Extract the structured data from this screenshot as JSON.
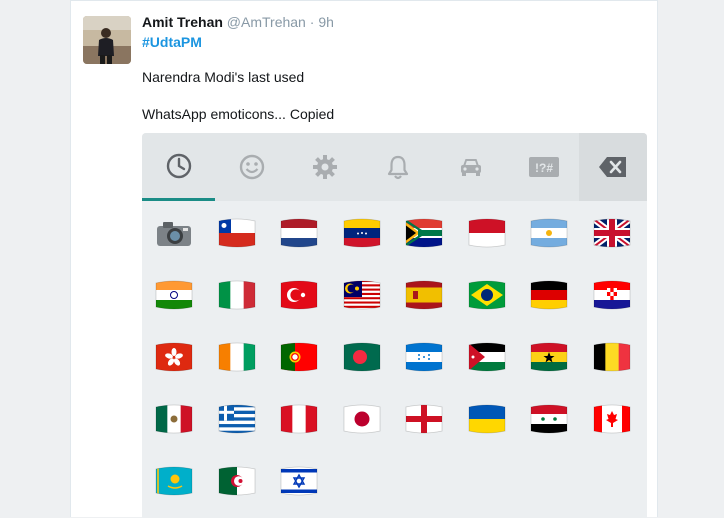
{
  "tweet": {
    "name": "Amit Trehan",
    "handle": "@AmTrehan",
    "separator": "·",
    "time": "9h",
    "hashtag": "#UdtaPM",
    "line1": "Narendra Modi's last used",
    "line2": "WhatsApp emoticons... Copied"
  },
  "keyboard": {
    "tabs": [
      "recent-icon",
      "smiley-icon",
      "gear-icon",
      "bell-icon",
      "car-icon",
      "symbols-icon"
    ],
    "symbols_label": "!?#",
    "active_tab": 0,
    "accent": "#1a8c86",
    "emojis": [
      "camera",
      "chile",
      "netherlands",
      "venezuela",
      "south-africa",
      "indonesia",
      "argentina",
      "united-kingdom",
      "india",
      "italy",
      "turkey",
      "malaysia",
      "spain",
      "brazil",
      "germany",
      "croatia",
      "hong-kong",
      "ivory-coast",
      "portugal",
      "bangladesh",
      "honduras",
      "jordan",
      "ghana",
      "belgium",
      "mexico",
      "greece",
      "peru",
      "japan",
      "england",
      "ukraine",
      "syria",
      "canada",
      "kazakhstan",
      "algeria",
      "israel"
    ]
  }
}
